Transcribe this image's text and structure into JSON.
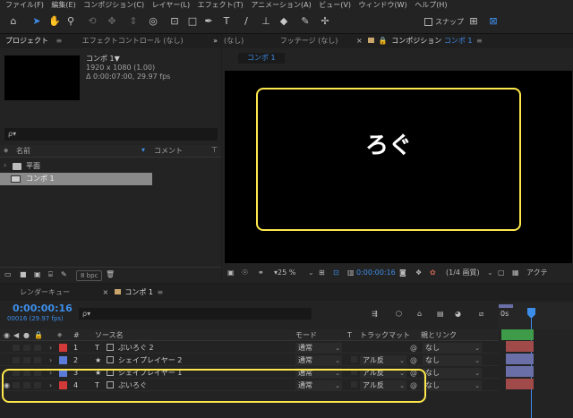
{
  "menu": [
    "ファイル(F)",
    "編集(E)",
    "コンポジション(C)",
    "レイヤー(L)",
    "エフェクト(T)",
    "アニメーション(A)",
    "ビュー(V)",
    "ウィンドウ(W)",
    "ヘルプ(H)"
  ],
  "toolbar": {
    "snap_label": "スナップ"
  },
  "project_panel": {
    "tab_project": "プロジェクト",
    "tab_effects": "エフェクトコントロール (なし)",
    "comp_name": "コンポ 1▼",
    "comp_resolution": "1920 x 1080 (1.00)",
    "comp_duration": "Δ 0:00:07:00, 29.97 fps",
    "search_placeholder": "ρ▾",
    "col_name": "名前",
    "col_comment": "コメント",
    "items": [
      {
        "name": "平面",
        "type": "folder"
      },
      {
        "name": "コンポ 1",
        "type": "comp"
      }
    ],
    "bpc": "8 bpc"
  },
  "viewer": {
    "tab_left": "(なし)",
    "tab_footage": "フッテージ (なし)",
    "tab_comp_prefix": "コンポジション",
    "tab_comp_name": "コンポ 1",
    "breadcrumb": "コンポ 1",
    "canvas_text": "ろぐ",
    "zoom": "25 %",
    "timecode": "0:00:00:16",
    "quality": "(1/4 画質)",
    "active_label": "アクテ"
  },
  "timeline": {
    "tab_render": "レンダーキュー",
    "tab_comp": "コンポ 1",
    "timecode": "0:00:00:16",
    "frame_info": "00016 (29.97 fps)",
    "search_placeholder": "ρ▾",
    "ruler_label": "0s",
    "headers": {
      "num": "#",
      "source": "ソース名",
      "mode": "モード",
      "t": "T",
      "trackmatte": "トラックマット",
      "parent": "親とリンク"
    },
    "layers": [
      {
        "num": "1",
        "type": "T",
        "name": "ぷいろぐ 2",
        "mode": "通常",
        "trackmatte": "",
        "parent": "なし",
        "label_color": "#d23a3a"
      },
      {
        "num": "2",
        "type": "★",
        "name": "シェイプレイヤー 2",
        "mode": "通常",
        "trackmatte": "アル反",
        "parent": "なし",
        "label_color": "#5a7bd8"
      },
      {
        "num": "3",
        "type": "★",
        "name": "シェイプレイヤー 1",
        "mode": "通常",
        "trackmatte": "アル反",
        "parent": "なし",
        "label_color": "#5a7bd8"
      },
      {
        "num": "4",
        "type": "T",
        "name": "ぷいろぐ",
        "mode": "通常",
        "trackmatte": "アル反",
        "parent": "なし",
        "label_color": "#d23a3a"
      }
    ]
  },
  "colors": {
    "accent": "#3d8eea",
    "highlight": "#ffe84d",
    "track_blue": "#6a6fa8",
    "track_red": "#a14a4a",
    "track_green": "#3e9b4a"
  }
}
